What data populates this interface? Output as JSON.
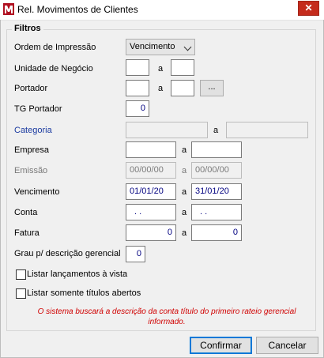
{
  "window": {
    "title": "Rel. Movimentos de Clientes",
    "close_label": "✕"
  },
  "filters": {
    "group_title": "Filtros",
    "ordem_impressao": {
      "label": "Ordem de Impressão",
      "value": "Vencimento"
    },
    "unidade_negocio": {
      "label": "Unidade de Negócio",
      "sep": "a",
      "from": "",
      "to": ""
    },
    "portador": {
      "label": "Portador",
      "sep": "a",
      "from": "",
      "to": "",
      "button": "..."
    },
    "tg_portador": {
      "label": "TG Portador",
      "value": "0"
    },
    "categoria": {
      "label": "Categoria",
      "sep": "a",
      "from": "",
      "to": ""
    },
    "empresa": {
      "label": "Empresa",
      "sep": "a",
      "from": "",
      "to": ""
    },
    "emissao": {
      "label": "Emissão",
      "sep": "a",
      "from": "00/00/00",
      "to": "00/00/00"
    },
    "vencimento": {
      "label": "Vencimento",
      "sep": "a",
      "from": "01/01/20",
      "to": "31/01/20"
    },
    "conta": {
      "label": "Conta",
      "sep": "a",
      "from": ". .",
      "to": ". ."
    },
    "fatura": {
      "label": "Fatura",
      "sep": "a",
      "from": "0",
      "to": "0"
    },
    "grau": {
      "label": "Grau p/ descrição gerencial",
      "value": "0"
    },
    "listar_a_vista": {
      "label": "Listar lançamentos à vista",
      "checked": false
    },
    "listar_abertos": {
      "label": "Listar somente títulos abertos",
      "checked": false
    },
    "note": "O sistema buscará a descrição da conta título do primeiro rateio gerencial informado."
  },
  "buttons": {
    "confirm": "Confirmar",
    "cancel": "Cancelar"
  },
  "colors": {
    "accent": "#0078d7",
    "close": "#c42b1c",
    "note": "#d00000",
    "link_label": "#1a3aa0"
  }
}
